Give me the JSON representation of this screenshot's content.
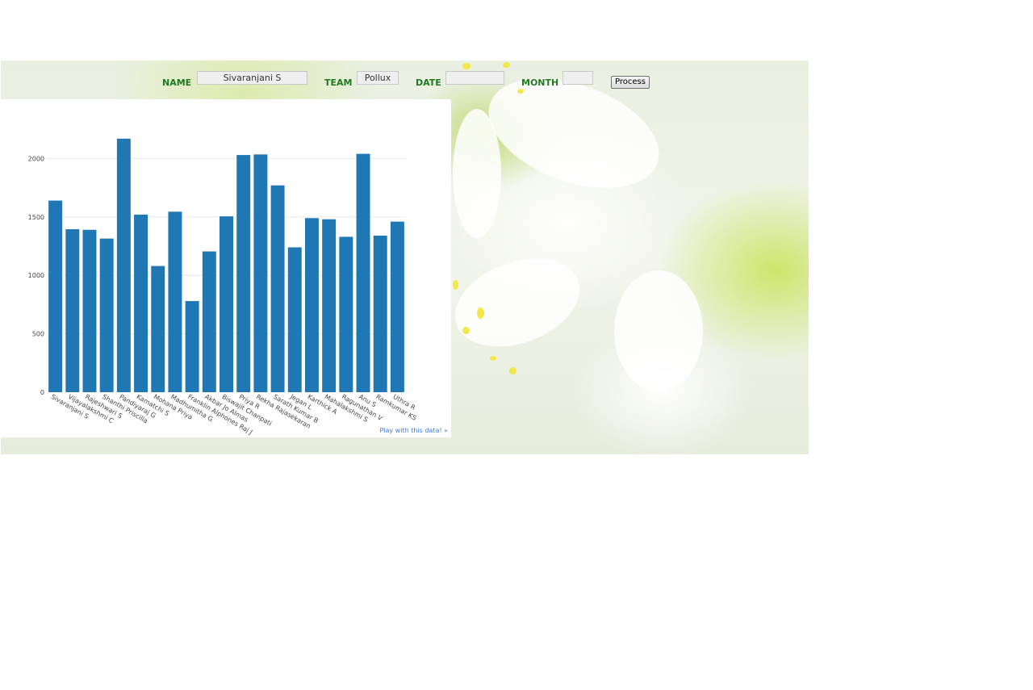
{
  "form": {
    "name_label": "NAME",
    "name_value": "Sivaranjani S",
    "team_label": "TEAM",
    "team_value": "Pollux",
    "date_label": "DATE",
    "date_value": "",
    "month_label": "MONTH",
    "month_value": "",
    "process_label": "Process"
  },
  "colors": {
    "label_green": "#1f7a1f",
    "bar_blue": "#1f77b4",
    "link_blue": "#447adb"
  },
  "chart_link_text": "Play with this data! »",
  "chart_data": {
    "type": "bar",
    "categories": [
      "Sivaranjani S",
      "Vijayalakshmi C",
      "Rajeshwari S",
      "Shanthi Priscilla",
      "Pandiyaraj G",
      "Kamatchi S",
      "Mohana Priya",
      "Madhumitha G",
      "Franklin Alphones Raj J",
      "Akbar Jo Almas",
      "Biswajit Chanpati",
      "Priya R",
      "Rekha Rajasekaran",
      "Sarath Kumar B",
      "Jegan L",
      "Karthick A",
      "Mahalakshmi S",
      "Ragunathan V",
      "Anu S",
      "Ramkumar KS",
      "Uthra R"
    ],
    "values": [
      1640,
      1395,
      1390,
      1315,
      2170,
      1520,
      1080,
      1545,
      780,
      1205,
      1505,
      2030,
      2035,
      1770,
      1240,
      1490,
      1480,
      1330,
      2040,
      1340,
      1460
    ],
    "ylim": [
      0,
      2300
    ],
    "yticks": [
      0,
      500,
      1000,
      1500,
      2000
    ],
    "grid": true,
    "title": "",
    "xlabel": "",
    "ylabel": ""
  }
}
